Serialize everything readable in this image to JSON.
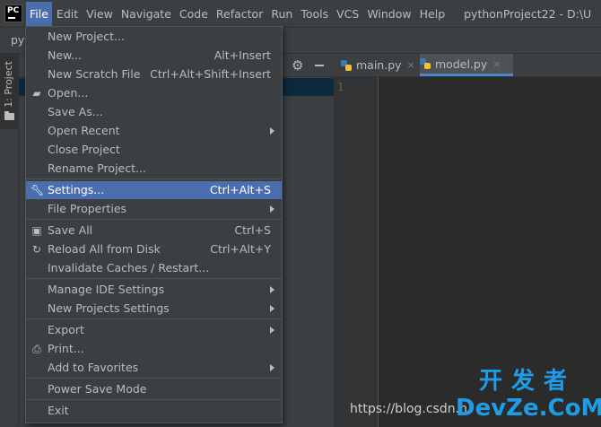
{
  "menubar": {
    "items": [
      "File",
      "Edit",
      "View",
      "Navigate",
      "Code",
      "Refactor",
      "Run",
      "Tools",
      "VCS",
      "Window",
      "Help"
    ],
    "title": "pythonProject22 - D:\\U"
  },
  "nav": {
    "crumb": "pyt"
  },
  "sidebar": {
    "project_tab": "1: Project"
  },
  "editor": {
    "tabs": [
      {
        "label": "main.py",
        "close": "×"
      },
      {
        "label": "model.py",
        "close": "×"
      }
    ],
    "line_number": "1"
  },
  "file_menu": {
    "items": [
      {
        "label": "New Project...",
        "shortcut": ""
      },
      {
        "label": "New...",
        "shortcut": "Alt+Insert"
      },
      {
        "label": "New Scratch File",
        "shortcut": "Ctrl+Alt+Shift+Insert"
      },
      {
        "label": "Open...",
        "shortcut": ""
      },
      {
        "label": "Save As...",
        "shortcut": ""
      },
      {
        "label": "Open Recent",
        "shortcut": ""
      },
      {
        "label": "Close Project",
        "shortcut": ""
      },
      {
        "label": "Rename Project...",
        "shortcut": ""
      },
      {
        "label": "Settings...",
        "shortcut": "Ctrl+Alt+S"
      },
      {
        "label": "File Properties",
        "shortcut": ""
      },
      {
        "label": "Save All",
        "shortcut": "Ctrl+S"
      },
      {
        "label": "Reload All from Disk",
        "shortcut": "Ctrl+Alt+Y"
      },
      {
        "label": "Invalidate Caches / Restart...",
        "shortcut": ""
      },
      {
        "label": "Manage IDE Settings",
        "shortcut": ""
      },
      {
        "label": "New Projects Settings",
        "shortcut": ""
      },
      {
        "label": "Export",
        "shortcut": ""
      },
      {
        "label": "Print...",
        "shortcut": ""
      },
      {
        "label": "Add to Favorites",
        "shortcut": ""
      },
      {
        "label": "Power Save Mode",
        "shortcut": ""
      },
      {
        "label": "Exit",
        "shortcut": ""
      }
    ]
  },
  "watermark": {
    "url": "https://blog.csdn.n",
    "logo_line1": "开发者",
    "logo_line2": "DevZe.CoM"
  },
  "colors": {
    "menu_highlight": "#4b6eaf",
    "background": "#2b2b2b",
    "menu_bg": "#3c3f41"
  }
}
